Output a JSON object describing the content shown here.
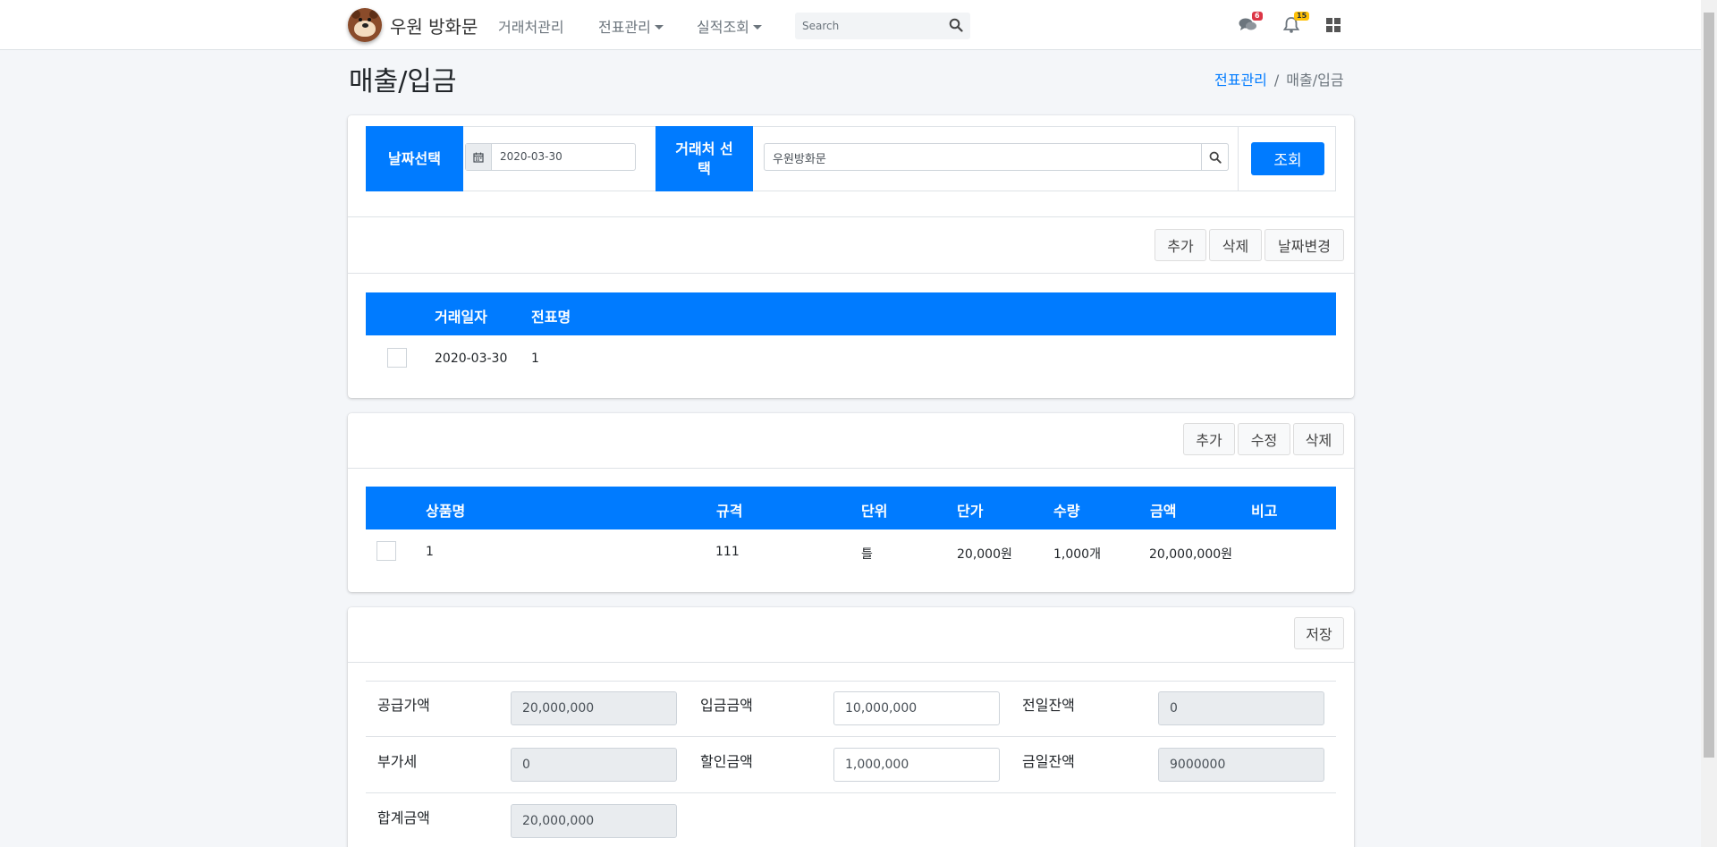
{
  "navbar": {
    "brand": "우원 방화문",
    "menu": {
      "vendor_mgmt": "거래처관리",
      "slip_mgmt": "전표관리",
      "perf_query": "실적조회"
    },
    "search_placeholder": "Search",
    "messages_count": "6",
    "notifications_count": "15"
  },
  "page": {
    "title": "매출/입금",
    "breadcrumb": [
      "전표관리",
      "/",
      "매출/입금"
    ]
  },
  "filter": {
    "date_label": "날짜선택",
    "date_value": "2020-03-30",
    "vendor_label": "거래처 선\n택",
    "vendor_value": "우원방화문",
    "query_button": "조회"
  },
  "slips": {
    "buttons": {
      "add": "추가",
      "delete": "삭제",
      "change_date": "날짜변경"
    },
    "headers": [
      "거래일자",
      "전표명"
    ],
    "rows": [
      {
        "date": "2020-03-30",
        "name": "1"
      }
    ]
  },
  "items": {
    "buttons": {
      "add": "추가",
      "edit": "수정",
      "delete": "삭제"
    },
    "headers": [
      "상품명",
      "규격",
      "단위",
      "단가",
      "수량",
      "금액",
      "비고"
    ],
    "rows": [
      {
        "name": "1",
        "spec": "111",
        "unit": "틀",
        "price": "20,000원",
        "qty": "1,000개",
        "amount": "20,000,000원",
        "note": ""
      }
    ]
  },
  "summary": {
    "save_button": "저장",
    "supply_label": "공급가액",
    "supply_value": "20,000,000",
    "deposit_label": "입금금액",
    "deposit_value": "10,000,000",
    "prev_balance_label": "전일잔액",
    "prev_balance_value": "0",
    "vat_label": "부가세",
    "vat_value": "0",
    "discount_label": "할인금액",
    "discount_value": "1,000,000",
    "today_balance_label": "금일잔액",
    "today_balance_value": "9000000",
    "total_label": "합계금액",
    "total_value": "20,000,000"
  },
  "colors": {
    "primary": "#007bff",
    "badge_red": "#dc3545",
    "badge_yellow": "#ffc107"
  }
}
